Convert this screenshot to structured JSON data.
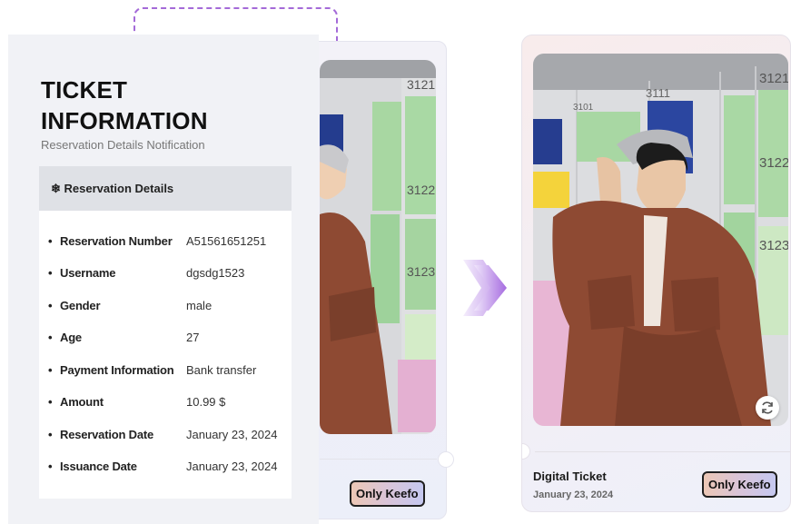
{
  "info_panel": {
    "title_line1": "TICKET",
    "title_line2": "INFORMATION",
    "subtitle": "Reservation Details Notification",
    "details_header": "❄ Reservation Details",
    "rows": [
      {
        "label": "Reservation Number",
        "value": "A51561651251"
      },
      {
        "label": "Username",
        "value": "dgsdg1523"
      },
      {
        "label": "Gender",
        "value": "male"
      },
      {
        "label": "Age",
        "value": "27"
      },
      {
        "label": "Payment Information",
        "value": "Bank transfer"
      },
      {
        "label": "Amount",
        "value": "10.99 $"
      },
      {
        "label": "Reservation Date",
        "value": "January 23, 2024"
      },
      {
        "label": "Issuance Date",
        "value": "January 23, 2024"
      }
    ]
  },
  "ticket": {
    "title": "Digital Ticket",
    "date": "January 23, 2024",
    "badge": "Only Keefo",
    "locker_numbers": [
      "3101",
      "3111",
      "3121",
      "3122",
      "3123"
    ]
  },
  "ticket_back": {
    "badge": "Only Keefo",
    "locker_numbers": [
      "3121",
      "3122",
      "3123"
    ]
  },
  "icons": {
    "refresh": "refresh-icon",
    "arrow": "double-chevron-right-icon",
    "connector": "dashed-connector"
  },
  "colors": {
    "accent": "#a46ad8",
    "panel_bg": "#f1f2f6",
    "header_bg": "#dfe1e6",
    "jacket": "#8e4a33"
  }
}
